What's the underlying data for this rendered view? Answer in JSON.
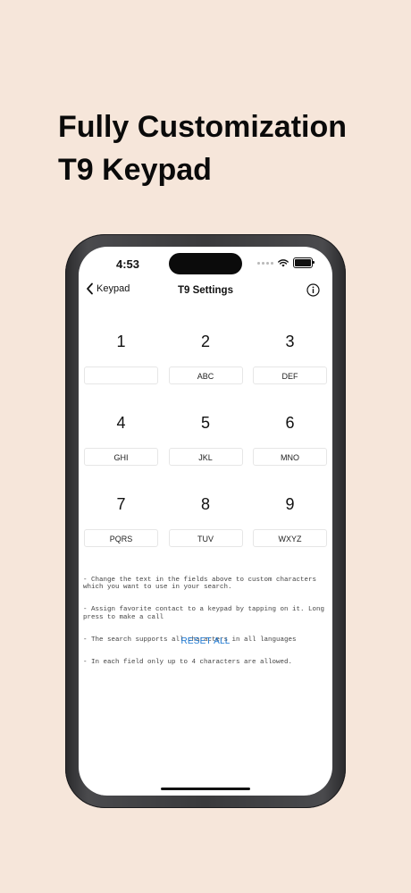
{
  "headline": {
    "line1": "Fully Customization",
    "line2": "T9 Keypad"
  },
  "status": {
    "time": "4:53"
  },
  "nav": {
    "back_label": "Keypad",
    "title": "T9 Settings",
    "info_icon": "info-icon"
  },
  "keypad": [
    [
      {
        "digit": "1",
        "letters": ""
      },
      {
        "digit": "2",
        "letters": "ABC"
      },
      {
        "digit": "3",
        "letters": "DEF"
      }
    ],
    [
      {
        "digit": "4",
        "letters": "GHI"
      },
      {
        "digit": "5",
        "letters": "JKL"
      },
      {
        "digit": "6",
        "letters": "MNO"
      }
    ],
    [
      {
        "digit": "7",
        "letters": "PQRS"
      },
      {
        "digit": "8",
        "letters": "TUV"
      },
      {
        "digit": "9",
        "letters": "WXYZ"
      }
    ]
  ],
  "notes": {
    "line1": "- Change the text in the fields above to custom characters which you want to use in your search.",
    "line2": "- Assign favorite contact to a keypad by tapping on it. Long press to make a call",
    "line3": "- The search supports all characters in all languages",
    "line4": "- In each field only up to 4 characters are allowed."
  },
  "reset_label": "RESET ALL",
  "colors": {
    "background": "#f6e6da",
    "accent": "#1976d2"
  }
}
